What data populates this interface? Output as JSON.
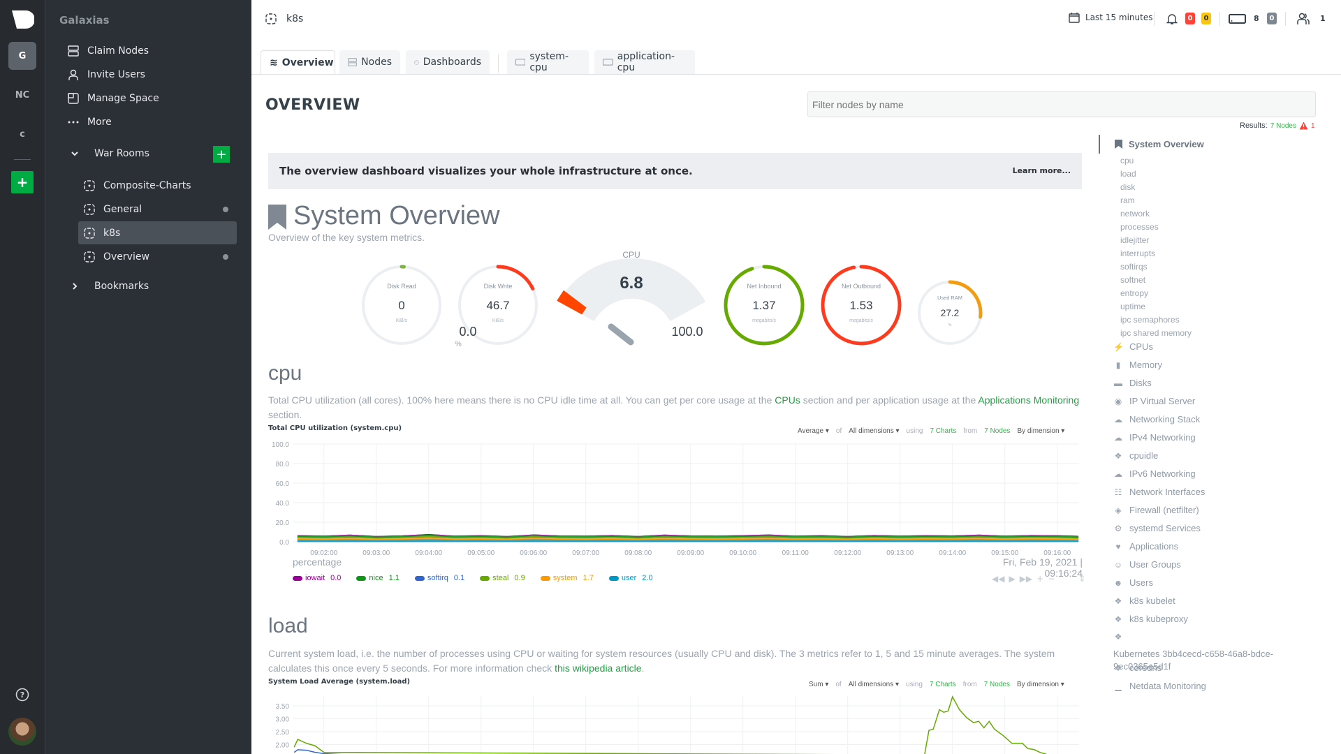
{
  "rail": {
    "spaces": [
      "G",
      "NC",
      "c"
    ],
    "add_label": "+"
  },
  "sidebar": {
    "space_name": "Galaxias",
    "items": [
      {
        "label": "Claim Nodes",
        "icon": "server-icon"
      },
      {
        "label": "Invite Users",
        "icon": "user-icon"
      },
      {
        "label": "Manage Space",
        "icon": "manage-space-icon"
      },
      {
        "label": "More",
        "icon": "more-dots-icon"
      }
    ],
    "war_rooms_label": "War Rooms",
    "rooms": [
      {
        "label": "Composite-Charts",
        "dot": false
      },
      {
        "label": "General",
        "dot": true
      },
      {
        "label": "k8s",
        "dot": false,
        "active": true
      },
      {
        "label": "Overview",
        "dot": true
      }
    ],
    "bookmarks_label": "Bookmarks"
  },
  "topbar": {
    "room": "k8s",
    "time_range": "Last 15 minutes",
    "alerts_critical": "0",
    "alerts_warning": "0",
    "nodes_count": "8",
    "nodes_offline": "0",
    "users_count": "1",
    "colors": {
      "critical": "#ff4136",
      "warning": "#f9c513",
      "offline": "#7d8791"
    }
  },
  "tabs": [
    {
      "label": "Overview",
      "active": true
    },
    {
      "label": "Nodes"
    },
    {
      "label": "Dashboards"
    },
    {
      "label": "system-cpu"
    },
    {
      "label": "application-cpu"
    }
  ],
  "main": {
    "title": "OVERVIEW",
    "filter_placeholder": "Filter nodes by name",
    "results_label": "Results:",
    "results_nodes": "7 Nodes",
    "results_alerts": "1",
    "banner_text": "The overview dashboard visualizes your whole infrastructure at once.",
    "banner_link": "Learn more...",
    "section_title": "System Overview",
    "section_subtitle": "Overview of the key system metrics."
  },
  "gauges": [
    {
      "title": "Disk Read",
      "value": "0",
      "unit": "KiB/s",
      "fill": 0.01,
      "color": "#7cb342"
    },
    {
      "title": "Disk Write",
      "value": "46.7",
      "unit": "KiB/s",
      "fill": 0.18,
      "color": "#ff3b1f"
    },
    {
      "title": "Net Inbound",
      "value": "1.37",
      "unit": "megabits/s",
      "fill": 0.95,
      "color": "#66aa00"
    },
    {
      "title": "Net Outbound",
      "value": "1.53",
      "unit": "megabits/s",
      "fill": 0.97,
      "color": "#ff3b1f"
    },
    {
      "title": "Used RAM",
      "value": "27.2",
      "unit": "%",
      "fill": 0.272,
      "color": "#f39c12"
    }
  ],
  "cpu_gauge": {
    "title": "CPU",
    "value": "6.8",
    "min": "0.0",
    "max": "100.0",
    "unit": "%",
    "level": 6.8
  },
  "cpu_section": {
    "heading": "cpu",
    "desc_pre": "Total CPU utilization (all cores). 100% here means there is no CPU idle time at all. You can get per core usage at the ",
    "desc_link1": "CPUs",
    "desc_mid": " section and per application usage at the ",
    "desc_link2": "Applications Monitoring",
    "desc_post": " section.",
    "chart_title": "Total CPU utilization (system.cpu)",
    "agg": "Average",
    "of": "of",
    "dims": "All dimensions",
    "using": "using",
    "charts": "7 Charts",
    "from": "from",
    "nodes": "7 Nodes",
    "group": "By dimension",
    "units": "percentage",
    "timestamp": "Fri, Feb 19, 2021 | 09:16:24"
  },
  "load_section": {
    "heading": "load",
    "desc_pre": "Current system load, i.e. the number of processes using CPU or waiting for system resources (usually CPU and disk). The 3 metrics refer to 1, 5 and 15 minute averages. The system calculates this once every 5 seconds. For more information check ",
    "desc_link": "this wikipedia article",
    "desc_post": ".",
    "chart_title": "System Load Average (system.load)",
    "agg": "Sum",
    "of": "of",
    "dims": "All dimensions",
    "using": "using",
    "charts": "7 Charts",
    "from": "from",
    "nodes": "7 Nodes",
    "group": "By dimension"
  },
  "toc": {
    "active": "System Overview",
    "sub": [
      "cpu",
      "load",
      "disk",
      "ram",
      "network",
      "processes",
      "idlejitter",
      "interrupts",
      "softirqs",
      "softnet",
      "entropy",
      "uptime",
      "ipc semaphores",
      "ipc shared memory"
    ],
    "sections": [
      {
        "label": "CPUs",
        "icon": "bolt-icon"
      },
      {
        "label": "Memory",
        "icon": "memory-icon"
      },
      {
        "label": "Disks",
        "icon": "disk-icon"
      },
      {
        "label": "IP Virtual Server",
        "icon": "eye-icon"
      },
      {
        "label": "Networking Stack",
        "icon": "cloud-icon"
      },
      {
        "label": "IPv4 Networking",
        "icon": "cloud-icon"
      },
      {
        "label": "cpuidle",
        "icon": "puzzle-icon"
      },
      {
        "label": "IPv6 Networking",
        "icon": "cloud-icon"
      },
      {
        "label": "Network Interfaces",
        "icon": "sitemap-icon"
      },
      {
        "label": "Firewall (netfilter)",
        "icon": "shield-icon"
      },
      {
        "label": "systemd Services",
        "icon": "gears-icon"
      },
      {
        "label": "Applications",
        "icon": "heartbeat-icon"
      },
      {
        "label": "User Groups",
        "icon": "users-icon"
      },
      {
        "label": "Users",
        "icon": "user-icon"
      },
      {
        "label": "k8s kubelet",
        "icon": "puzzle-icon"
      },
      {
        "label": "k8s kubeproxy",
        "icon": "puzzle-icon"
      },
      {
        "label": "Kubernetes 3bb4cecd-c658-46a8-bdce-9ec0365e5d1f",
        "icon": "puzzle-icon"
      },
      {
        "label": "coredns",
        "icon": "puzzle-icon"
      },
      {
        "label": "Netdata Monitoring",
        "icon": "bar-chart-icon"
      }
    ]
  },
  "chart_data": [
    {
      "type": "area",
      "title": "Total CPU utilization (system.cpu)",
      "ylabel": "percentage",
      "ylim": [
        0,
        100
      ],
      "yticks": [
        "100.0",
        "80.0",
        "60.0",
        "40.0",
        "20.0",
        "0.0"
      ],
      "xticks": [
        "09:02:00",
        "09:03:00",
        "09:04:00",
        "09:05:00",
        "09:06:00",
        "09:07:00",
        "09:08:00",
        "09:09:00",
        "09:10:00",
        "09:11:00",
        "09:12:00",
        "09:13:00",
        "09:14:00",
        "09:15:00",
        "09:16:00"
      ],
      "xlim": [
        "09:01:25",
        "09:16:25"
      ],
      "grid": true,
      "stacked": true,
      "x": [
        "09:01:30",
        "09:02:00",
        "09:02:30",
        "09:03:00",
        "09:03:30",
        "09:04:00",
        "09:04:30",
        "09:05:00",
        "09:05:30",
        "09:06:00",
        "09:06:30",
        "09:07:00",
        "09:07:30",
        "09:08:00",
        "09:08:30",
        "09:09:00",
        "09:09:30",
        "09:10:00",
        "09:10:30",
        "09:11:00",
        "09:11:30",
        "09:12:00",
        "09:12:30",
        "09:13:00",
        "09:13:30",
        "09:14:00",
        "09:14:30",
        "09:15:00",
        "09:15:30",
        "09:16:00",
        "09:16:24"
      ],
      "series": [
        {
          "name": "user",
          "latest": "2.0",
          "color": "#0099c6",
          "values": [
            2.4,
            2.2,
            2.6,
            2.1,
            2.3,
            2.9,
            2.2,
            2.4,
            2.1,
            2.8,
            2.3,
            2.2,
            2.5,
            2.1,
            2.6,
            2.3,
            2.2,
            2.4,
            2.7,
            2.2,
            2.3,
            2.1,
            2.5,
            2.2,
            2.4,
            2.3,
            2.6,
            2.2,
            2.5,
            2.3,
            2.0
          ]
        },
        {
          "name": "system",
          "latest": "1.7",
          "color": "#ff9900",
          "values": [
            1.8,
            1.7,
            1.9,
            1.6,
            1.8,
            2.0,
            1.7,
            1.8,
            1.6,
            1.9,
            1.7,
            1.7,
            1.8,
            1.6,
            1.9,
            1.7,
            1.7,
            1.8,
            1.9,
            1.7,
            1.8,
            1.6,
            1.8,
            1.7,
            1.8,
            1.7,
            1.9,
            1.7,
            1.8,
            1.8,
            1.7
          ]
        },
        {
          "name": "softirq",
          "latest": "0.1",
          "color": "#3366cc",
          "values": [
            0.1,
            0.1,
            0.1,
            0.1,
            0.1,
            0.1,
            0.1,
            0.1,
            0.1,
            0.1,
            0.1,
            0.1,
            0.1,
            0.1,
            0.1,
            0.1,
            0.1,
            0.1,
            0.1,
            0.1,
            0.1,
            0.1,
            0.1,
            0.1,
            0.1,
            0.1,
            0.1,
            0.1,
            0.1,
            0.1,
            0.1
          ]
        },
        {
          "name": "steal",
          "latest": "0.9",
          "color": "#66aa00",
          "values": [
            1.0,
            0.9,
            1.1,
            0.8,
            0.9,
            1.2,
            0.9,
            1.0,
            0.8,
            1.1,
            0.9,
            0.9,
            1.0,
            0.8,
            1.1,
            0.9,
            0.9,
            1.0,
            1.1,
            0.9,
            1.0,
            0.8,
            1.0,
            0.9,
            1.0,
            0.9,
            1.1,
            0.9,
            1.0,
            1.0,
            0.9
          ]
        },
        {
          "name": "nice",
          "latest": "1.1",
          "color": "#109618",
          "values": [
            1.2,
            1.1,
            1.3,
            1.0,
            1.1,
            1.4,
            1.1,
            1.2,
            1.0,
            1.3,
            1.1,
            1.1,
            1.2,
            1.0,
            1.3,
            1.1,
            1.1,
            1.2,
            1.3,
            1.1,
            1.2,
            1.0,
            1.2,
            1.1,
            1.2,
            1.1,
            1.3,
            1.1,
            1.2,
            1.2,
            1.1
          ]
        },
        {
          "name": "iowait",
          "latest": "0.0",
          "color": "#990099",
          "values": [
            0,
            0,
            0,
            0,
            0,
            0,
            0,
            0,
            0,
            0,
            0,
            0,
            0,
            0,
            0,
            0,
            0,
            0,
            0,
            0,
            0,
            0,
            0,
            0,
            0,
            0,
            0,
            0,
            0,
            0,
            0
          ]
        }
      ]
    },
    {
      "type": "line",
      "title": "System Load Average (system.load)",
      "yticks": [
        "3.50",
        "3.00",
        "2.50",
        "2.00"
      ],
      "xlim": [
        "09:01:25",
        "09:16:25"
      ],
      "grid": true,
      "series": [
        {
          "color": "#66aa00",
          "x": [
            "09:01:26",
            "09:01:30",
            "09:01:40",
            "09:01:50",
            "09:02:00",
            "09:13:28",
            "09:13:33",
            "09:13:38",
            "09:13:45",
            "09:13:50",
            "09:13:55",
            "09:14:00",
            "09:14:08",
            "09:14:16",
            "09:14:24",
            "09:14:30",
            "09:14:36",
            "09:14:42",
            "09:14:48",
            "09:14:58",
            "09:15:08",
            "09:15:14",
            "09:15:20",
            "09:15:26",
            "09:15:34",
            "09:15:40",
            "09:15:50"
          ],
          "values": [
            1.9,
            2.2,
            2.05,
            1.95,
            1.7,
            1.6,
            2.55,
            2.6,
            3.35,
            3.25,
            3.3,
            3.85,
            3.35,
            3.05,
            2.85,
            2.9,
            2.65,
            2.9,
            2.6,
            2.35,
            2.05,
            2.05,
            2.05,
            1.85,
            1.8,
            1.7,
            1.6
          ]
        },
        {
          "color": "#3366cc",
          "x": [
            "09:01:26",
            "09:01:30",
            "09:01:40",
            "09:01:50",
            "09:02:00",
            "09:02:30"
          ],
          "values": [
            1.7,
            1.8,
            1.78,
            1.7,
            1.65,
            1.6
          ]
        }
      ]
    }
  ]
}
